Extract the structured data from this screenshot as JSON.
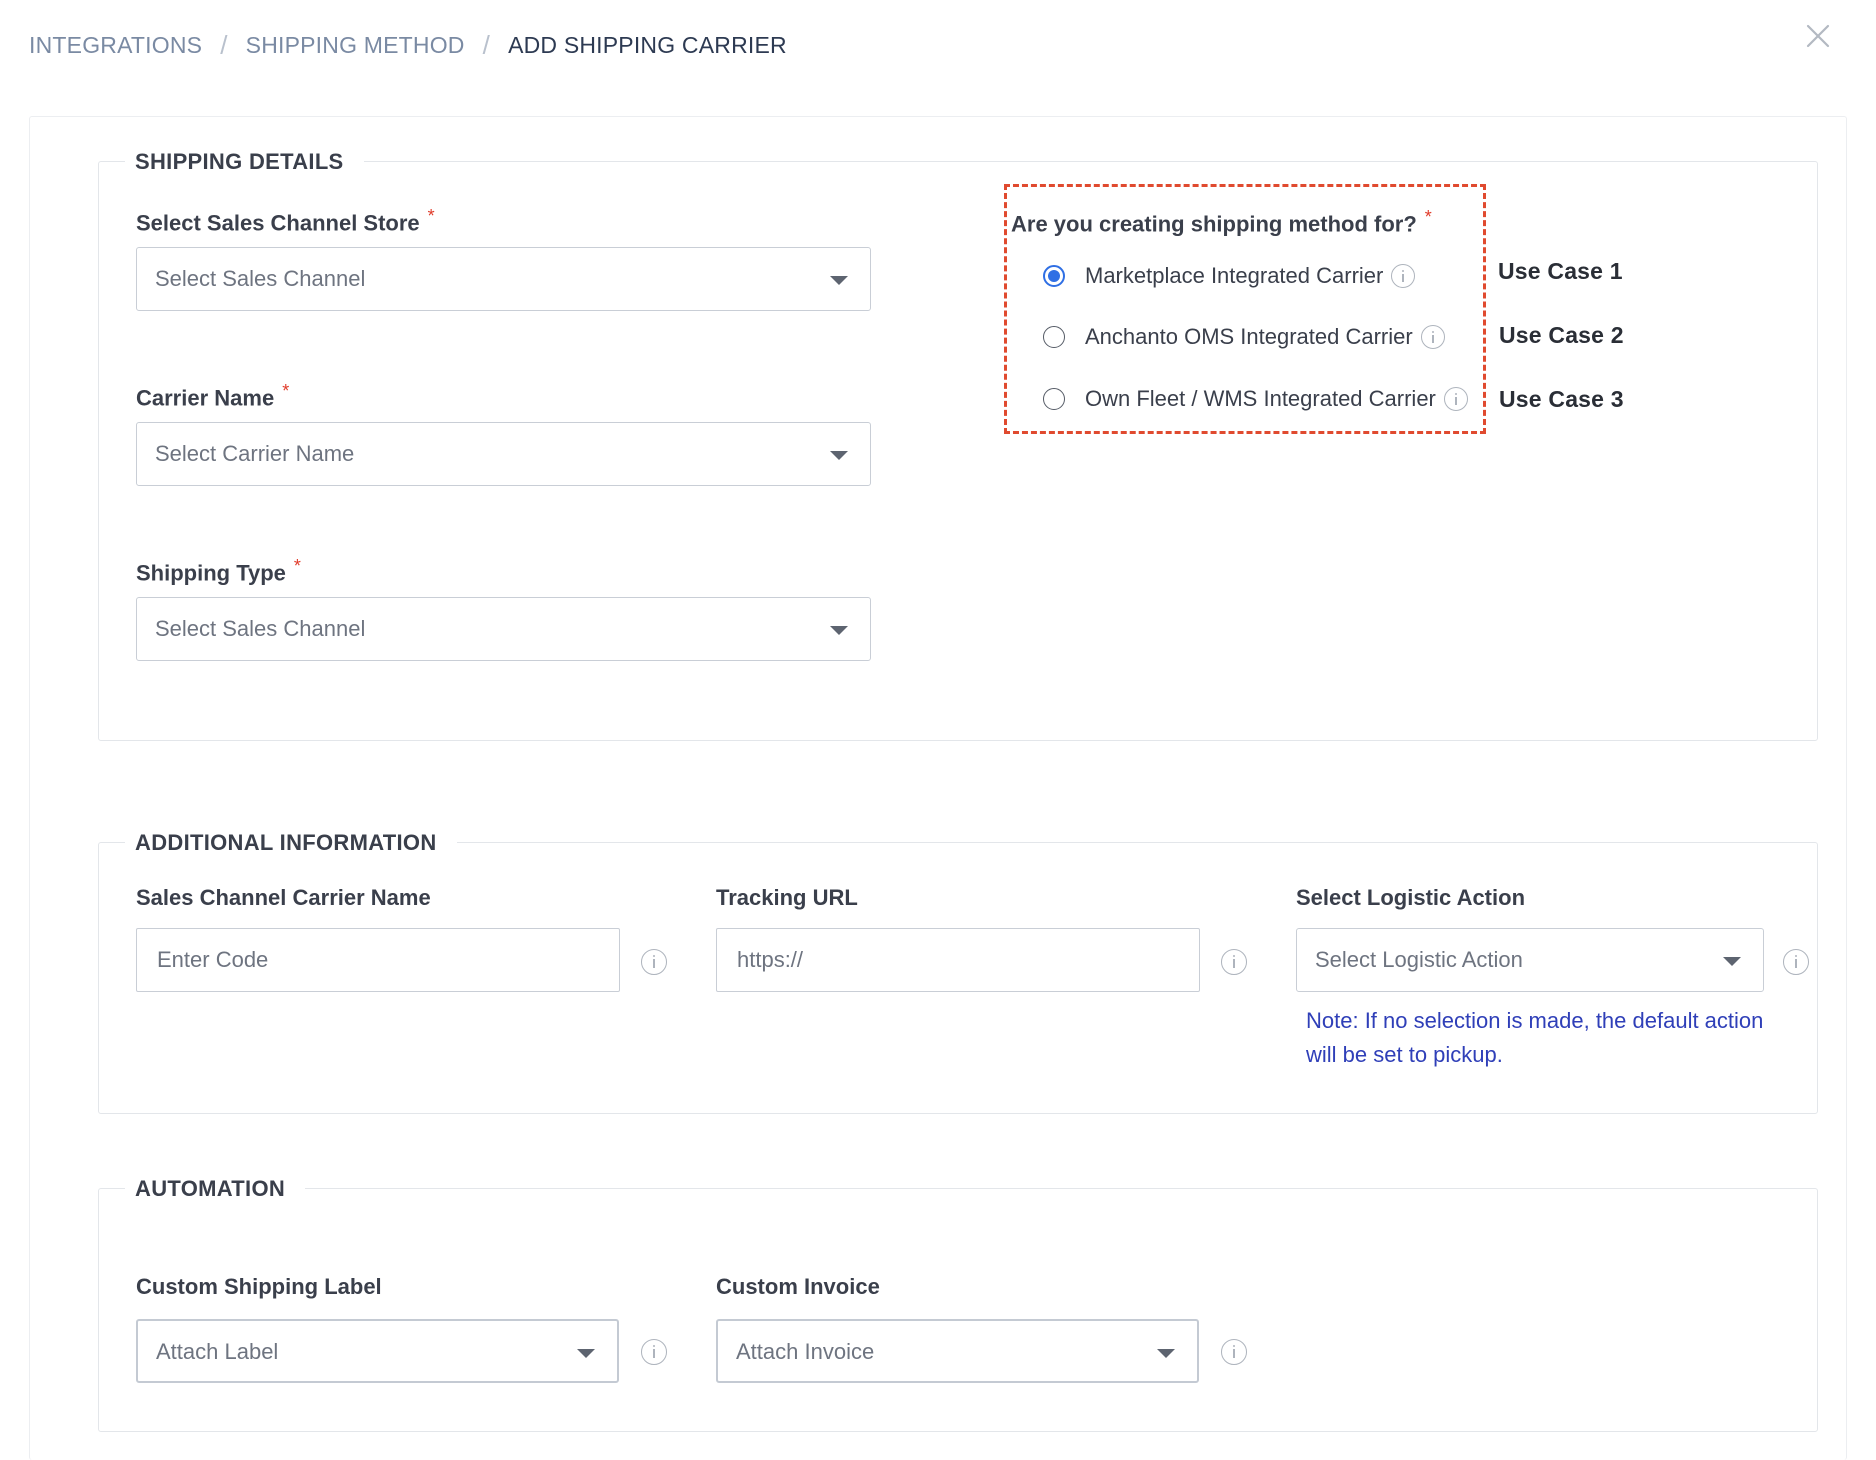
{
  "breadcrumb": {
    "items": [
      "INTEGRATIONS",
      "SHIPPING METHOD",
      "ADD SHIPPING CARRIER"
    ],
    "separator": "/"
  },
  "close_icon": "close-icon",
  "shipping_details": {
    "title": "SHIPPING DETAILS",
    "sales_channel_store": {
      "label": "Select Sales Channel Store",
      "required_mark": "*",
      "placeholder": "Select Sales Channel"
    },
    "carrier_name": {
      "label": "Carrier Name",
      "required_mark": "*",
      "placeholder": "Select Carrier Name"
    },
    "shipping_type": {
      "label": "Shipping Type",
      "required_mark": "*",
      "placeholder": "Select Sales Channel"
    },
    "method_for": {
      "question": "Are you creating shipping method for?",
      "required_mark": "*",
      "options": [
        {
          "label": "Marketplace Integrated Carrier",
          "selected": true,
          "use_case": "Use Case 1"
        },
        {
          "label": "Anchanto OMS Integrated Carrier",
          "selected": false,
          "use_case": "Use Case 2"
        },
        {
          "label": "Own Fleet / WMS Integrated Carrier",
          "selected": false,
          "use_case": "Use Case 3"
        }
      ]
    }
  },
  "additional_information": {
    "title": "ADDITIONAL INFORMATION",
    "sales_channel_carrier_name": {
      "label": "Sales Channel Carrier Name",
      "placeholder": "Enter Code"
    },
    "tracking_url": {
      "label": "Tracking URL",
      "placeholder": "https://"
    },
    "logistic_action": {
      "label": "Select Logistic Action",
      "placeholder": "Select Logistic Action"
    },
    "note": "Note: If no selection is made, the default action will be set to pickup."
  },
  "automation": {
    "title": "AUTOMATION",
    "custom_shipping_label": {
      "label": "Custom Shipping Label",
      "placeholder": "Attach Label"
    },
    "custom_invoice": {
      "label": "Custom Invoice",
      "placeholder": "Attach Invoice"
    }
  },
  "colors": {
    "accent": "#2f6fe4",
    "required": "#e03b2a",
    "highlight_border": "#e04a2f",
    "note_text": "#2f3fb8"
  }
}
